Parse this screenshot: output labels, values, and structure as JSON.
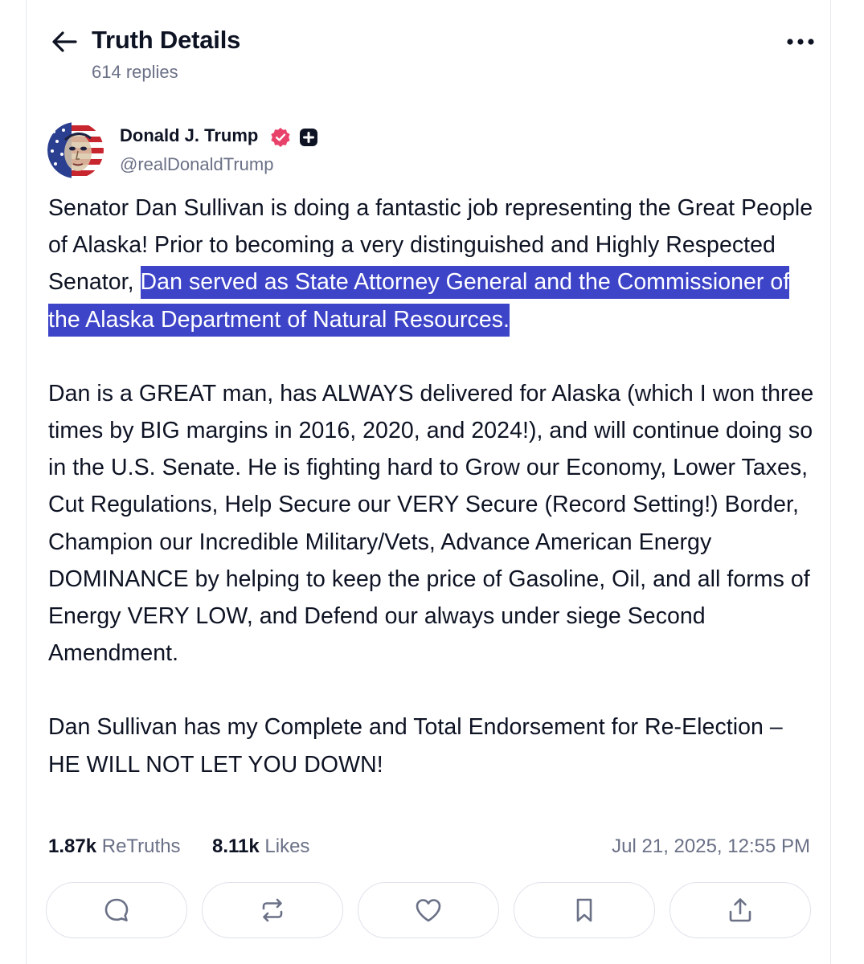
{
  "header": {
    "title": "Truth Details",
    "replies": "614 replies"
  },
  "author": {
    "name": "Donald J. Trump",
    "handle": "@realDonaldTrump",
    "verified_color": "#e8426b"
  },
  "post": {
    "p1_a": "Senator Dan Sullivan is doing a fantastic job representing the Great People of Alaska! Prior to becoming a very distinguished and Highly Respected Senator, ",
    "p1_highlighted": "Dan served as State Attorney General and the Commissioner of the Alaska Department of Natural Resources.",
    "p2": "Dan is a GREAT man, has ALWAYS delivered for Alaska (which I won three times by BIG margins in 2016, 2020, and 2024!), and will continue doing so in the U.S. Senate. He is fighting hard to Grow our Economy, Lower Taxes, Cut Regulations, Help Secure our VERY Secure (Record Setting!) Border, Champion our Incredible Military/Vets, Advance American Energy DOMINANCE by helping to keep the price of Gasoline, Oil, and all forms of Energy VERY LOW, and Defend our always under siege Second Amendment.",
    "p3": "Dan Sullivan has my Complete and Total Endorsement for Re-Election – HE WILL NOT LET YOU DOWN!",
    "highlight_color": "#3d44c8"
  },
  "stats": {
    "retruths_count": "1.87k",
    "retruths_label": "ReTruths",
    "likes_count": "8.11k",
    "likes_label": "Likes",
    "timestamp": "Jul 21, 2025, 12:55 PM"
  },
  "actions": [
    {
      "icon": "reply-icon"
    },
    {
      "icon": "retruth-icon"
    },
    {
      "icon": "like-icon"
    },
    {
      "icon": "bookmark-icon"
    },
    {
      "icon": "share-icon"
    }
  ]
}
